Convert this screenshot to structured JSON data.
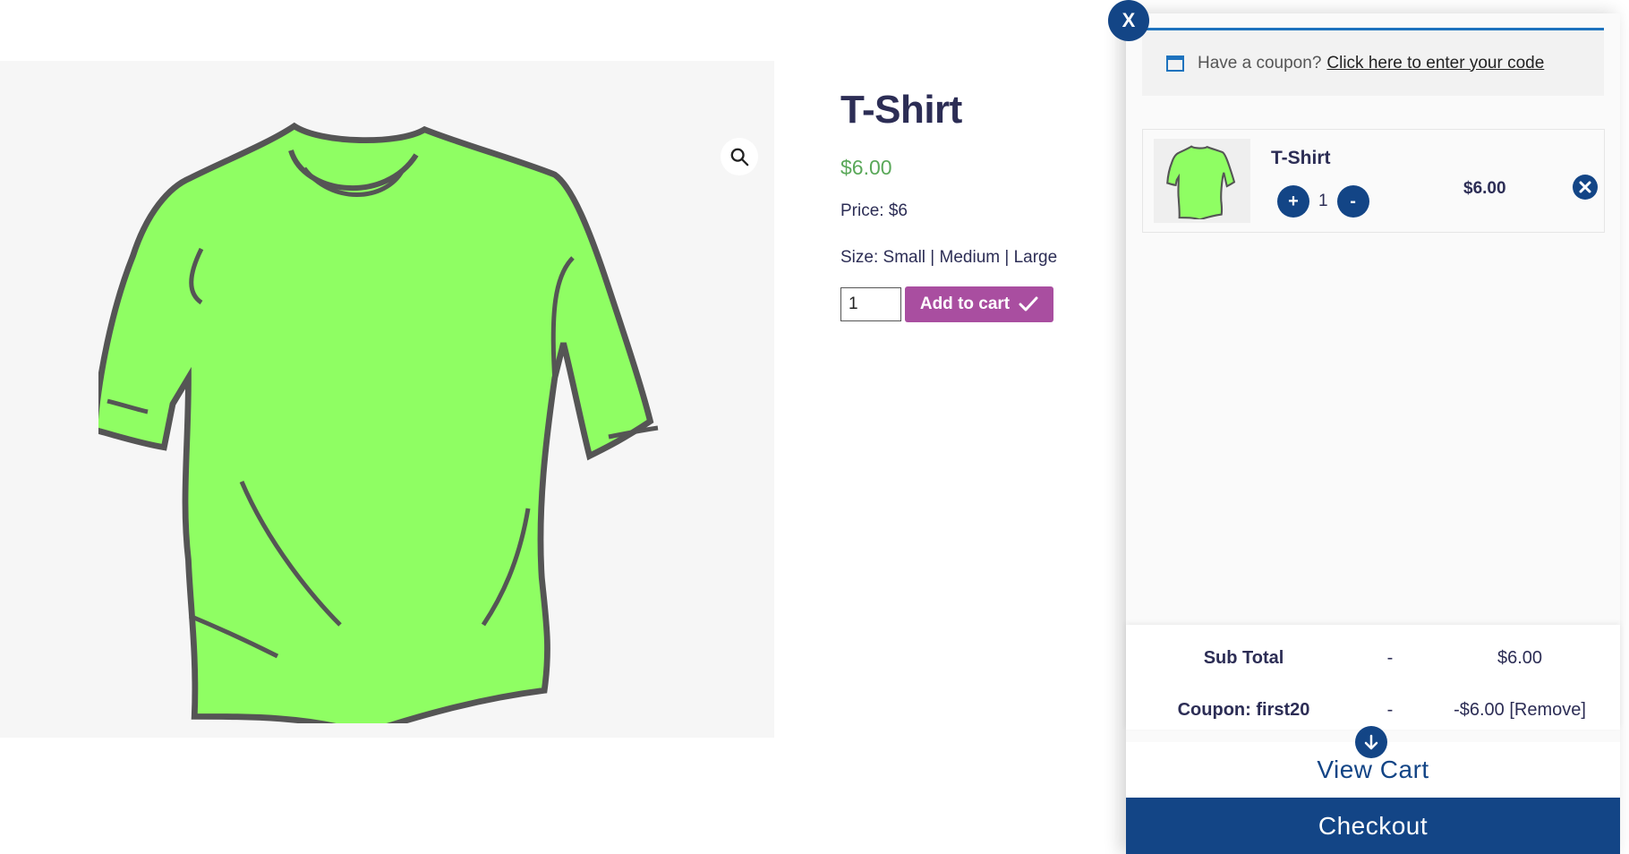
{
  "product": {
    "title": "T-Shirt",
    "price": "$6.00",
    "price_line": "Price: $6",
    "size_line": "Size: Small | Medium | Large",
    "quantity": "1",
    "add_to_cart_label": "Add to cart",
    "image_color": "#8ffe63"
  },
  "side_cart": {
    "close_label": "X",
    "coupon_notice": {
      "text": "Have a coupon?",
      "link": "Click here to enter your code"
    },
    "item": {
      "name": "T-Shirt",
      "plus_label": "+",
      "quantity": "1",
      "minus_label": "-",
      "price": "$6.00"
    },
    "totals": {
      "subtotal_label": "Sub Total",
      "subtotal_sep": "-",
      "subtotal_value": "$6.00",
      "coupon_label": "Coupon: first20",
      "coupon_sep": "-",
      "coupon_value": "-$6.00 [Remove]"
    },
    "view_cart_label": "View Cart",
    "checkout_label": "Checkout"
  },
  "colors": {
    "navy": "#134586",
    "add_button": "#a94ea0",
    "price_green": "#5aa859",
    "heading": "#2c2d55"
  },
  "icons": [
    "search-icon",
    "checkmark-icon",
    "calendar-icon",
    "close-circle-icon",
    "arrow-down-icon"
  ]
}
